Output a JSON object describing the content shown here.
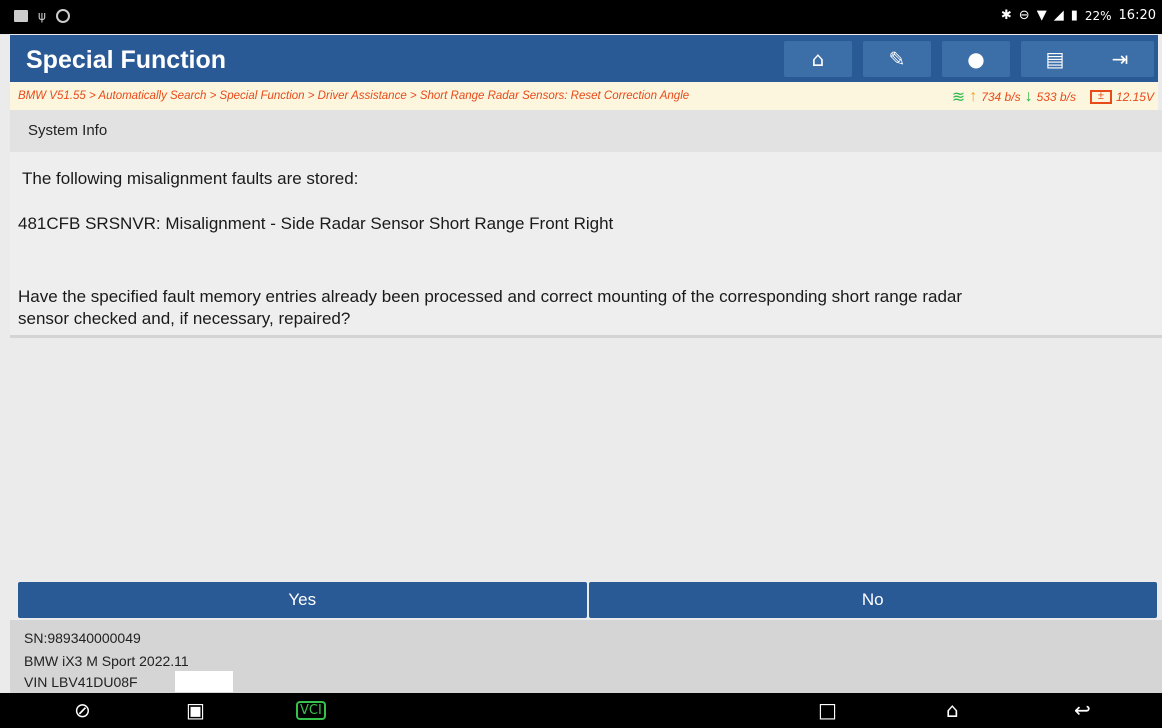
{
  "status_bar": {
    "battery_percent": "22%",
    "time": "16:20",
    "left_icons": [
      "image-icon",
      "usb-icon",
      "circle-icon"
    ],
    "right_icons": [
      "bluetooth-icon",
      "dnd-icon",
      "wifi-icon",
      "signal-icon",
      "battery-icon"
    ]
  },
  "header": {
    "title": "Special Function",
    "color": "#2a5a95",
    "buttons": [
      "home-icon",
      "edit-icon",
      "chat-icon",
      "print-icon",
      "exit-icon"
    ]
  },
  "breadcrumb": {
    "text": "BMW V51.55 > Automatically Search > Special Function > Driver Assistance > Short Range Radar Sensors: Reset Correction Angle",
    "upload": "734 b/s",
    "download": "533 b/s",
    "voltage": "12.15V"
  },
  "section": {
    "title": "System Info"
  },
  "messages": {
    "intro": "The following misalignment faults are stored:",
    "fault": "481CFB SRSNVR: Misalignment - Side Radar Sensor Short Range Front Right",
    "question_line1": "Have the specified fault memory entries already been processed and correct mounting of the corresponding short range radar",
    "question_line2": "sensor checked and, if necessary, repaired?"
  },
  "actions": {
    "yes": "Yes",
    "no": "No"
  },
  "footer": {
    "sn": "SN:989340000049",
    "vehicle": "BMW iX3 M Sport 2022.11",
    "vin": "VIN LBV41DU08F"
  },
  "nav_bar": {
    "vci_label": "VCI"
  }
}
